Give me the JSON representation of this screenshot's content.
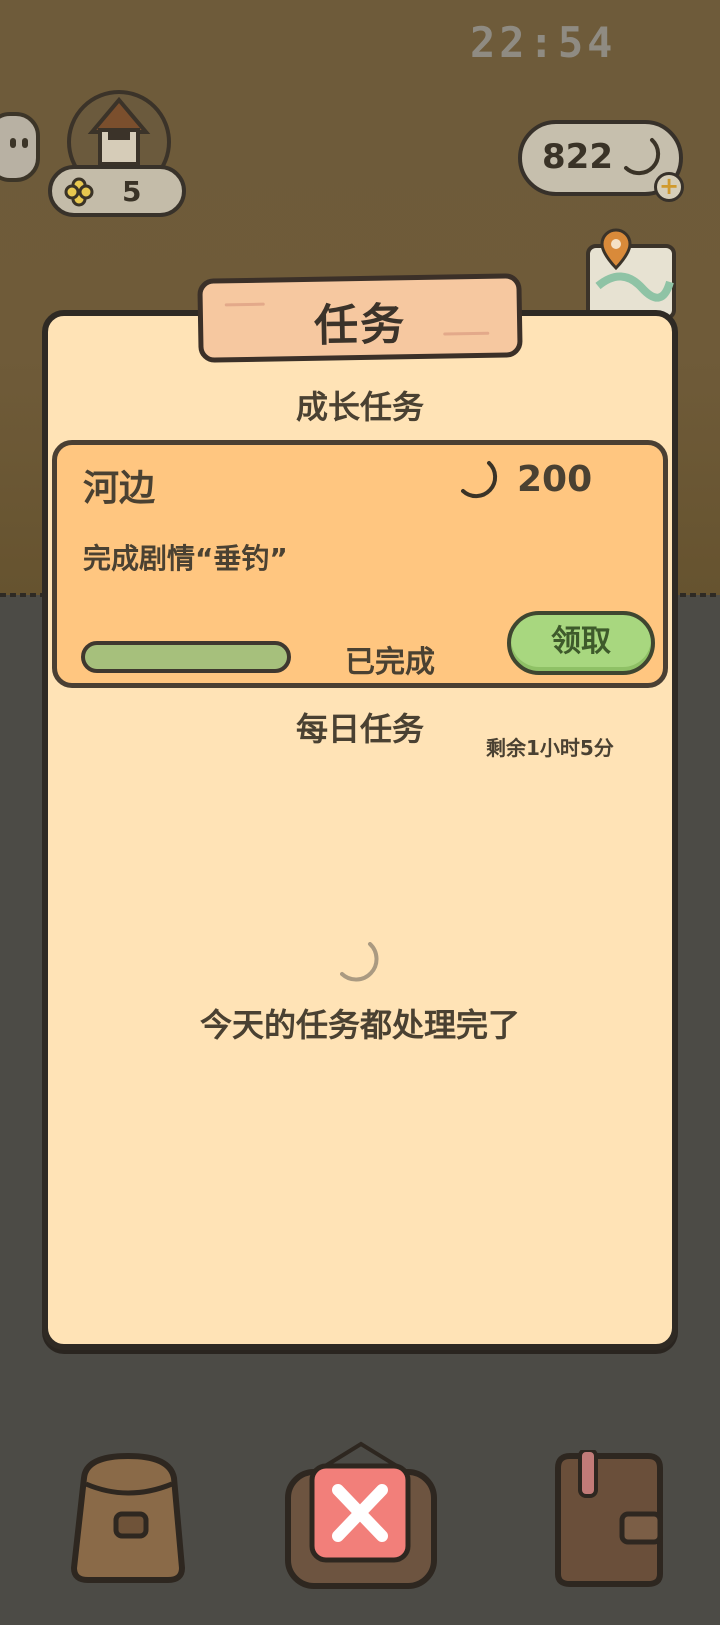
{
  "status_bar": {
    "time": "22:54"
  },
  "header": {
    "clover_count": "5",
    "currency_amount": "822"
  },
  "panel": {
    "title": "任务",
    "growth_section_title": "成长任务",
    "growth_task": {
      "name": "河边",
      "reward": "200",
      "description": "完成剧情“垂钓”",
      "progress": 1.0,
      "status": "已完成",
      "claim_label": "领取"
    },
    "daily_section_title": "每日任务",
    "daily_timer": "剩余1小时5分",
    "daily_empty_text": "今天的任务都处理完了"
  },
  "bottom_bar": {
    "items": [
      "backpack-icon",
      "close-icon",
      "journal-icon"
    ]
  },
  "colors": {
    "panel_bg": "#ffe3b6",
    "task_card_bg": "#ffc680",
    "claim_button": "#a8d77f",
    "close_button": "#f27f7a"
  }
}
